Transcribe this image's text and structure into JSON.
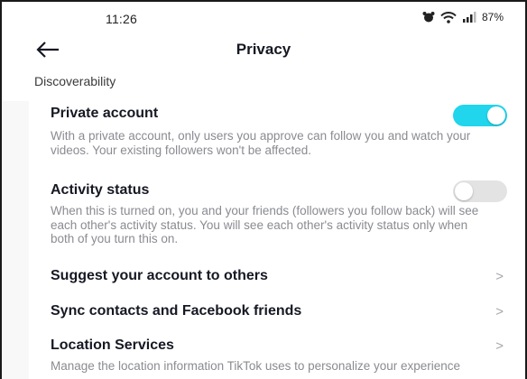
{
  "status_bar": {
    "time": "11:26",
    "battery": "87%",
    "icons": [
      "alarm-icon",
      "wifi-icon",
      "signal-icon"
    ]
  },
  "header": {
    "title": "Privacy",
    "back_icon": "back-arrow-icon"
  },
  "section": {
    "label": "Discoverability"
  },
  "settings": {
    "private_account": {
      "title": "Private account",
      "description": "With a private account, only users you approve can follow you and watch your videos. Your existing followers won't be affected.",
      "enabled": true
    },
    "activity_status": {
      "title": "Activity status",
      "description": "When this is turned on, you and your friends (followers you follow back) will see each other's activity status. You will see each other's activity status only when both of you turn this on.",
      "enabled": false
    },
    "suggest_account": {
      "title": "Suggest your account to others",
      "chevron": ">"
    },
    "sync_contacts": {
      "title": "Sync contacts and Facebook friends",
      "chevron": ">"
    },
    "location_services": {
      "title": "Location Services",
      "description": "Manage the location information TikTok uses to personalize your experience",
      "chevron": ">"
    }
  },
  "colors": {
    "toggle_on": "#20d5ec",
    "toggle_off": "#e3e3e4",
    "text_primary": "#161823",
    "text_secondary": "#8a8b91"
  }
}
